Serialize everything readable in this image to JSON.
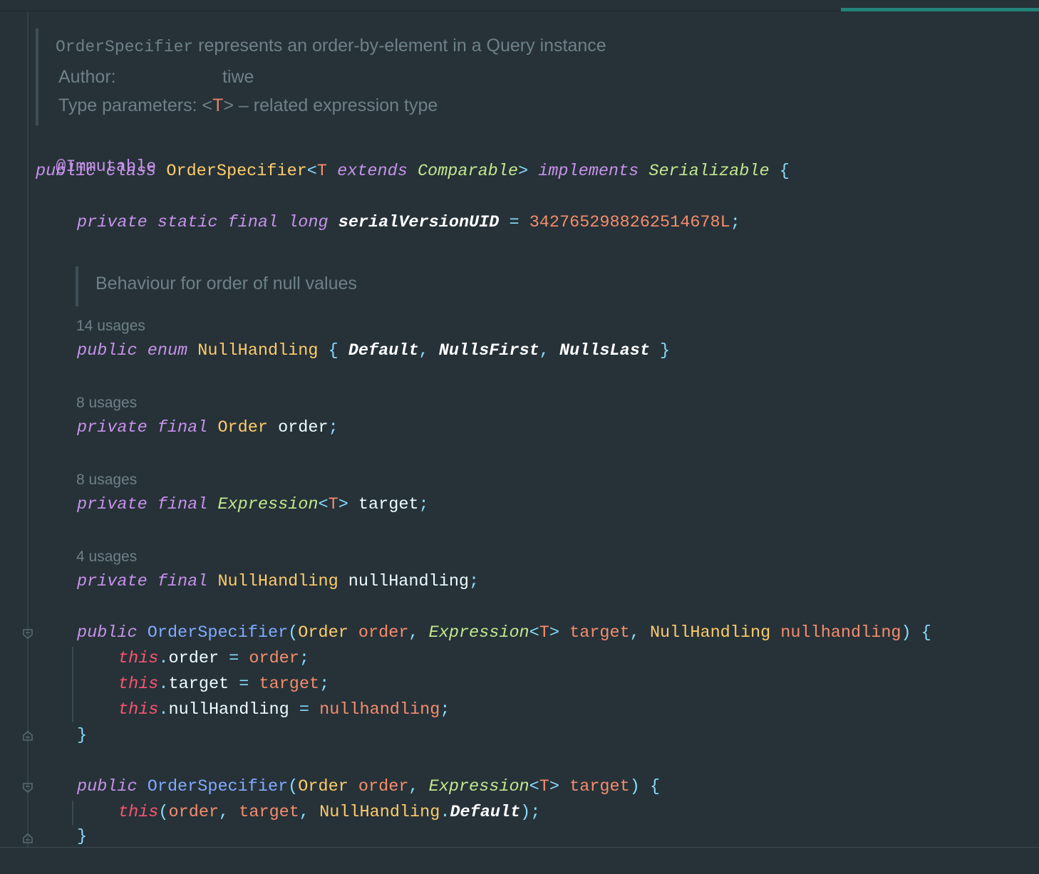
{
  "editor": {
    "doc_class": {
      "summary_code": "OrderSpecifier",
      "summary_rest": " represents an order-by-element in a Query instance",
      "author_label": "Author:",
      "author_value": "tiwe",
      "type_params_label": "Type parameters:",
      "type_params_open": "<",
      "type_params_T": "T",
      "type_params_close": ">",
      "type_params_desc": " – related expression type"
    },
    "doc_enum": {
      "text": "Behaviour for order of null values"
    },
    "usages": {
      "enum": "14 usages",
      "order": "8 usages",
      "target": "8 usages",
      "nullHandling": "4 usages"
    },
    "code": {
      "annotation": "@Immutable",
      "public": "public",
      "private": "private",
      "static": "static",
      "final": "final",
      "long": "long",
      "class": "class",
      "enum": "enum",
      "extends": "extends",
      "implements": "implements",
      "this": "this",
      "class_name": "OrderSpecifier",
      "T": "T",
      "Comparable": "Comparable",
      "Serializable": "Serializable",
      "serialVersionUID": "serialVersionUID",
      "serial_value": "3427652988262514678L",
      "NullHandling": "NullHandling",
      "Default": "Default",
      "NullsFirst": "NullsFirst",
      "NullsLast": "NullsLast",
      "Order": "Order",
      "Expression": "Expression",
      "order": "order",
      "target": "target",
      "nullHandling": "nullHandling",
      "nullhandling": "nullhandling"
    }
  },
  "colors": {
    "background": "#263238",
    "keyword": "#c792ea",
    "class": "#ffcb6b",
    "interface": "#c3e88d",
    "number": "#f78c6c",
    "method": "#82aaff",
    "this": "#ff5370",
    "punctuation": "#89ddff",
    "accent": "#22837a"
  }
}
